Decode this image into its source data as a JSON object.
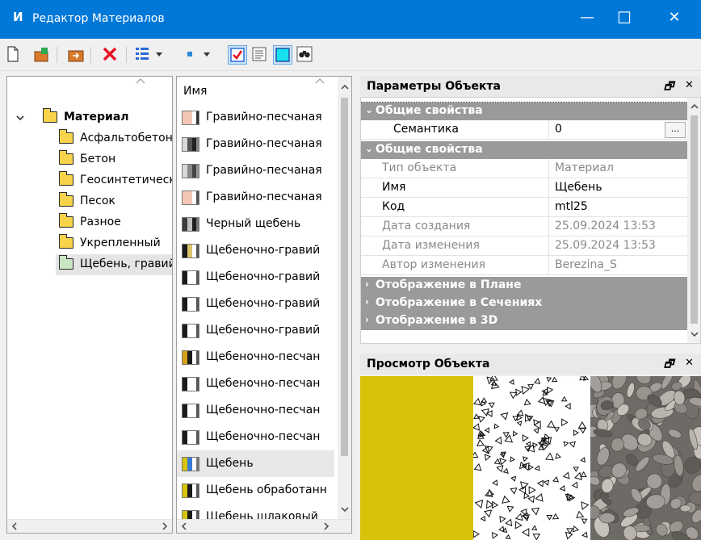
{
  "window": {
    "title": "Редактор Материалов",
    "app_icon_letter": "И",
    "minimize": "—",
    "maximize": "☐",
    "close": "✕"
  },
  "tree": {
    "root_label": "Материал",
    "items": [
      {
        "label": "Асфальтобетон"
      },
      {
        "label": "Бетон"
      },
      {
        "label": "Геосинтетические"
      },
      {
        "label": "Песок"
      },
      {
        "label": "Разное"
      },
      {
        "label": "Укрепленный"
      },
      {
        "label": "Щебень, гравий"
      }
    ],
    "selected_index": 6
  },
  "list": {
    "header": "Имя",
    "items": [
      {
        "label": "Гравийно-песчаная",
        "swatch": [
          "#f4c6b6",
          "#f4c6b6",
          "#ffffff",
          "#333333"
        ]
      },
      {
        "label": "Гравийно-песчаная",
        "swatch": [
          "#d9d9d9",
          "#555555",
          "#222222",
          "#888888"
        ]
      },
      {
        "label": "Гравийно-песчаная",
        "swatch": [
          "#d9d9d9",
          "#888888",
          "#444444",
          "#999999"
        ]
      },
      {
        "label": "Гравийно-песчаная",
        "swatch": [
          "#f4c6b6",
          "#f4c6b6",
          "#ffffff",
          "#555555"
        ]
      },
      {
        "label": "Черный щебень",
        "swatch": [
          "#3c3c3c",
          "#bfbfbf",
          "#1e1e1e",
          "#777777"
        ]
      },
      {
        "label": "Щебеночно-гравий",
        "swatch": [
          "#1a1a1a",
          "#d8c36b",
          "#ffffff",
          "#555555"
        ]
      },
      {
        "label": "Щебеночно-гравий",
        "swatch": [
          "#1a1a1a",
          "#ffffff",
          "#ffffff",
          "#555555"
        ]
      },
      {
        "label": "Щебеночно-гравий",
        "swatch": [
          "#1a1a1a",
          "#ffffff",
          "#ffffff",
          "#555555"
        ]
      },
      {
        "label": "Щебеночно-гравий",
        "swatch": [
          "#1a1a1a",
          "#ffffff",
          "#ffffff",
          "#555555"
        ]
      },
      {
        "label": "Щебеночно-песчан",
        "swatch": [
          "#d4a017",
          "#1a1a1a",
          "#ffffff",
          "#555555"
        ]
      },
      {
        "label": "Щебеночно-песчан",
        "swatch": [
          "#1a1a1a",
          "#ffffff",
          "#ffffff",
          "#555555"
        ]
      },
      {
        "label": "Щебеночно-песчан",
        "swatch": [
          "#1a1a1a",
          "#ffffff",
          "#ffffff",
          "#555555"
        ]
      },
      {
        "label": "Щебеночно-песчан",
        "swatch": [
          "#1a1a1a",
          "#ffffff",
          "#ffffff",
          "#555555"
        ]
      },
      {
        "label": "Щебень",
        "swatch": [
          "#d8c30a",
          "#3a7bd5",
          "#ffffff",
          "#777777"
        ]
      },
      {
        "label": "Щебень обработанн",
        "swatch": [
          "#d8c30a",
          "#1a1a1a",
          "#ffffff",
          "#555555"
        ]
      },
      {
        "label": "Щебень шлаковый",
        "swatch": [
          "#d8c30a",
          "#1a1a1a",
          "#ffffff",
          "#555555"
        ]
      }
    ],
    "selected_index": 13
  },
  "params": {
    "title": "Параметры Объекта",
    "section1": "Общие свойства",
    "semantic_label": "Семантика",
    "semantic_value": "0",
    "ellipsis": "...",
    "section2": "Общие свойства",
    "rows": [
      {
        "name": "Тип объекта",
        "value": "Материал",
        "muted": true
      },
      {
        "name": "Имя",
        "value": "Щебень",
        "muted": false
      },
      {
        "name": "Код",
        "value": "mtl25",
        "muted": false
      },
      {
        "name": "Дата создания",
        "value": "25.09.2024 13:53",
        "muted": true
      },
      {
        "name": "Дата изменения",
        "value": "25.09.2024 13:53",
        "muted": true
      },
      {
        "name": "Автор изменения",
        "value": "Berezina_S",
        "muted": true
      }
    ],
    "collapsed_sections": [
      "Отображение в Плане",
      "Отображение в Сечениях",
      "Отображение в 3D"
    ]
  },
  "preview": {
    "title": "Просмотр Объекта",
    "fill_color": "#d8c30a"
  },
  "colors": {
    "titlebar": "#0078d7",
    "section_bg": "#9a9a9a",
    "selection": "#e8e8e8"
  }
}
